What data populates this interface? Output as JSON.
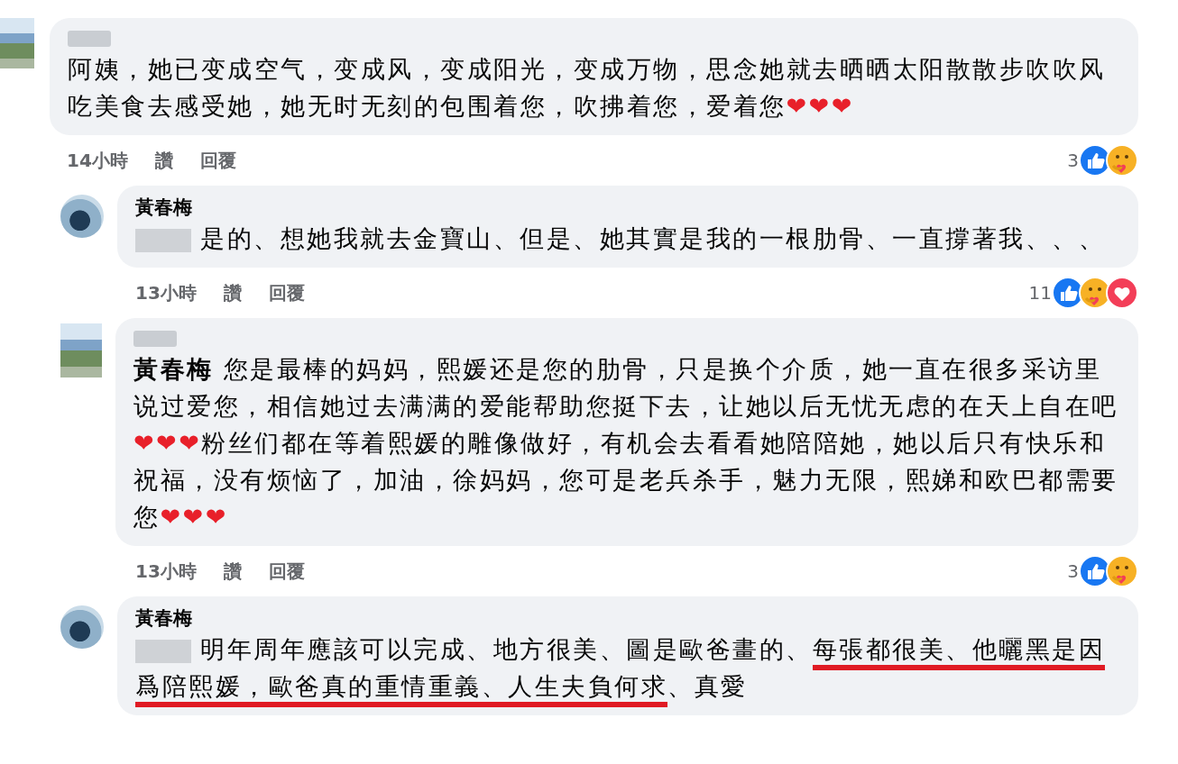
{
  "comments": [
    {
      "reply": false,
      "avatar": {
        "kind": "pixelated"
      },
      "author_blurred": true,
      "segments": [
        {
          "kind": "text",
          "text": "阿姨，她已变成空气，变成风，变成阳光，变成万物，思念她就去晒晒太阳散散步吹吹风吃美食去感受她，她无时无刻的包围着您，吹拂着您，爱着您"
        },
        {
          "kind": "hearts",
          "text": "❤❤❤"
        }
      ],
      "footer": {
        "time": "14小時",
        "like": "讚",
        "reply": "回覆",
        "count": "3",
        "reactions": [
          {
            "kind": "like"
          },
          {
            "kind": "care"
          }
        ]
      }
    },
    {
      "reply": true,
      "avatar": {
        "kind": "photo"
      },
      "author_blurred": false,
      "author": "黃春梅",
      "segments": [
        {
          "kind": "blurred"
        },
        {
          "kind": "text",
          "text": "是的、想她我就去金寶山、但是、她其實是我的一根肋骨、一直撐著我、、、"
        }
      ],
      "footer": {
        "time": "13小時",
        "like": "讚",
        "reply": "回覆",
        "count": "11",
        "reactions": [
          {
            "kind": "like"
          },
          {
            "kind": "care"
          },
          {
            "kind": "love"
          }
        ]
      }
    },
    {
      "reply": true,
      "avatar": {
        "kind": "pixelated"
      },
      "author_blurred": true,
      "segments": [
        {
          "kind": "mention",
          "text": "黃春梅"
        },
        {
          "kind": "text",
          "text": " 您是最棒的妈妈，熙媛还是您的肋骨，只是换个介质，她一直在很多采访里说过爱您，相信她过去满满的爱能帮助您挺下去，让她以后无忧无虑的在天上自在吧"
        },
        {
          "kind": "hearts",
          "text": "❤❤❤"
        },
        {
          "kind": "text",
          "text": "粉丝们都在等着熙媛的雕像做好，有机会去看看她陪陪她，她以后只有快乐和祝福，没有烦恼了，加油，徐妈妈，您可是老兵杀手，魅力无限，熙娣和欧巴都需要您"
        },
        {
          "kind": "hearts",
          "text": "❤❤❤"
        }
      ],
      "footer": {
        "time": "13小時",
        "like": "讚",
        "reply": "回覆",
        "count": "3",
        "reactions": [
          {
            "kind": "like"
          },
          {
            "kind": "care"
          }
        ]
      }
    },
    {
      "reply": true,
      "avatar": {
        "kind": "photo"
      },
      "author_blurred": false,
      "author": "黃春梅",
      "segments": [
        {
          "kind": "blurred"
        },
        {
          "kind": "text",
          "text": "明年周年應該可以完成、地方很美、圖是歐爸畫的、",
          "underlined": false
        },
        {
          "kind": "text",
          "text": "每張都很美、他曬黑是因爲陪熙媛，歐爸真的重情重義、人生夫負何求",
          "underlined": true
        },
        {
          "kind": "text",
          "text": "、真愛",
          "underlined": false
        }
      ]
    }
  ]
}
